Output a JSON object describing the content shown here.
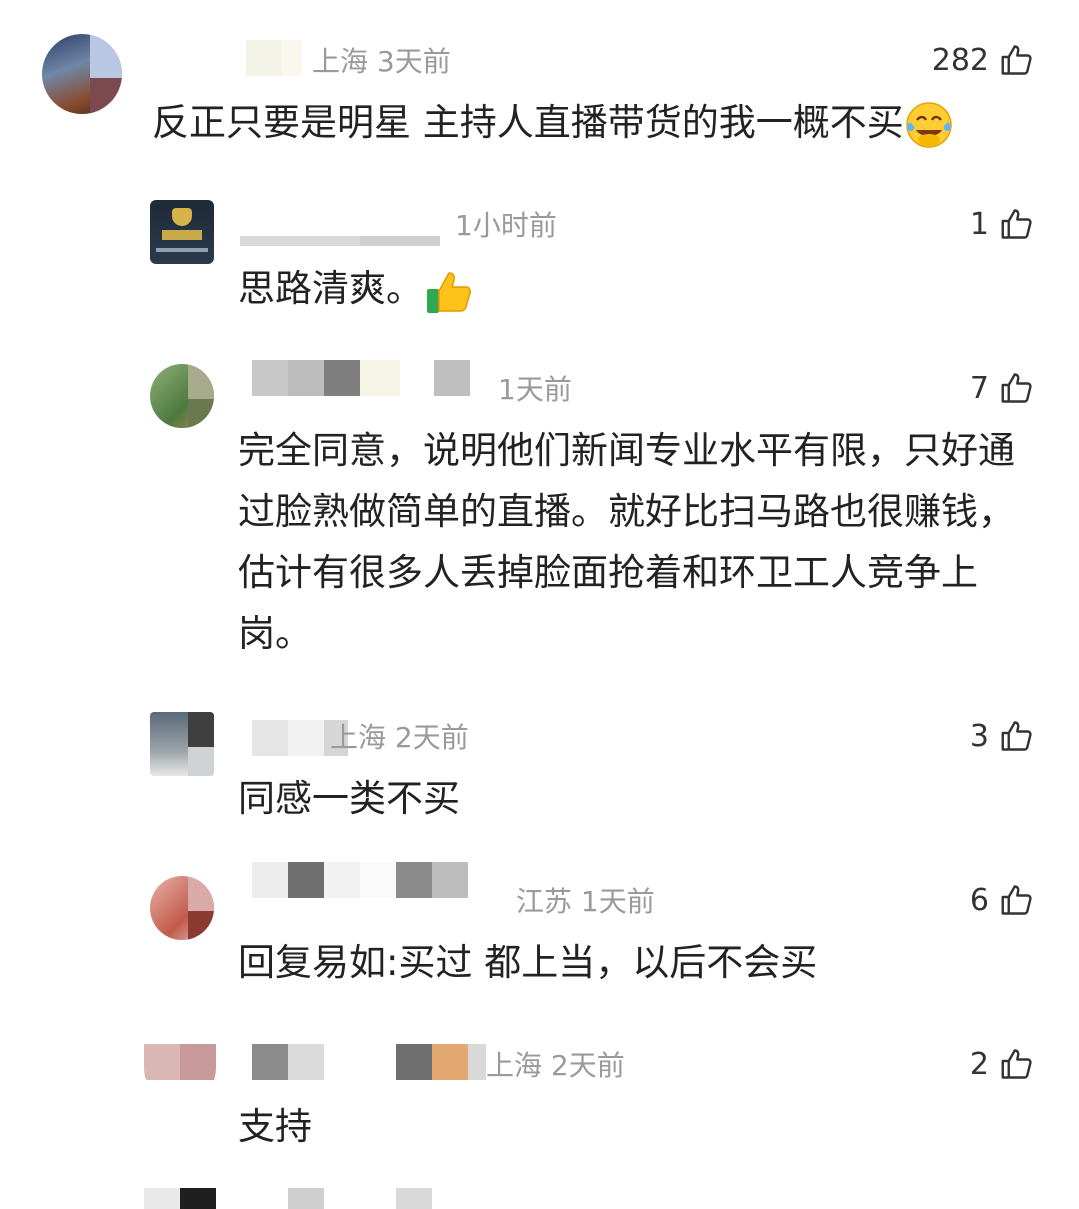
{
  "comments": [
    {
      "meta": "上海 3天前",
      "likes": "282",
      "text": "反正只要是明星 主持人直播带货的我一概不买",
      "emoji": "laugh-cry-emoji"
    },
    {
      "meta": "1小时前",
      "likes": "1",
      "text": "思路清爽。",
      "emoji": "thumbs-up-emoji"
    },
    {
      "meta": "1天前",
      "likes": "7",
      "text": "完全同意，说明他们新闻专业水平有限，只好通过脸熟做简单的直播。就好比扫马路也很赚钱，估计有很多人丢掉脸面抢着和环卫工人竞争上岗。"
    },
    {
      "meta": "上海 2天前",
      "likes": "3",
      "text": "同感一类不买"
    },
    {
      "meta": "江苏 1天前",
      "likes": "6",
      "text": "回复易如:买过 都上当，以后不会买"
    },
    {
      "meta": "上海 2天前",
      "likes": "2",
      "text": "支持"
    }
  ],
  "colors": {
    "meta": "#9a9a9a",
    "text": "#222222"
  }
}
